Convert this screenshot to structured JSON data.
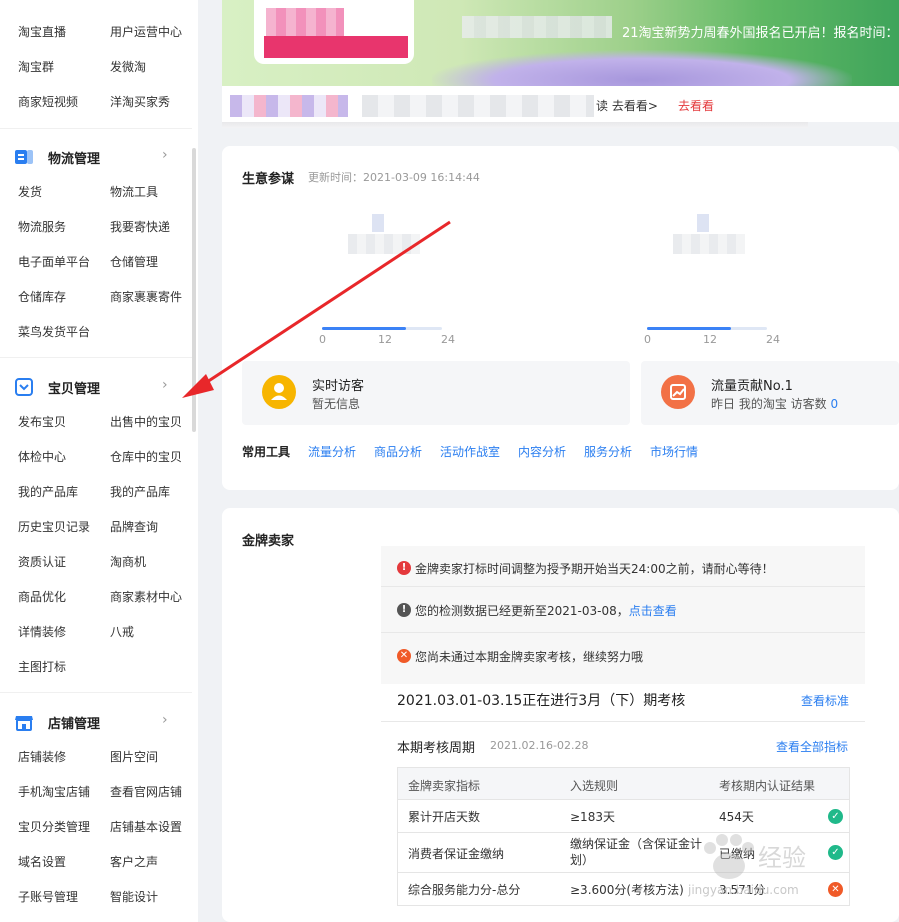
{
  "sidebar": {
    "top_links": [
      {
        "left": "淘宝直播",
        "right": "用户运营中心"
      },
      {
        "left": "淘宝群",
        "right": "发微淘"
      },
      {
        "left": "商家短视频",
        "right": "洋淘买家秀"
      }
    ],
    "sections": [
      {
        "title": "物流管理",
        "icon": "logistics-icon",
        "links": [
          {
            "left": "发货",
            "right": "物流工具"
          },
          {
            "left": "物流服务",
            "right": "我要寄快递"
          },
          {
            "left": "电子面单平台",
            "right": "仓储管理"
          },
          {
            "left": "仓储库存",
            "right": "商家裹裹寄件"
          },
          {
            "left": "菜鸟发货平台",
            "right": ""
          }
        ]
      },
      {
        "title": "宝贝管理",
        "icon": "product-icon",
        "links": [
          {
            "left": "发布宝贝",
            "right": "出售中的宝贝"
          },
          {
            "left": "体检中心",
            "right": "仓库中的宝贝"
          },
          {
            "left": "我的产品库",
            "right": "我的产品库"
          },
          {
            "left": "历史宝贝记录",
            "right": "品牌查询"
          },
          {
            "left": "资质认证",
            "right": "淘商机"
          },
          {
            "left": "商品优化",
            "right": "商家素材中心"
          },
          {
            "left": "详情装修",
            "right": "八戒"
          },
          {
            "left": "主图打标",
            "right": ""
          }
        ]
      },
      {
        "title": "店铺管理",
        "icon": "shop-icon",
        "links": [
          {
            "left": "店铺装修",
            "right": "图片空间"
          },
          {
            "left": "手机淘宝店铺",
            "right": "查看官网店铺"
          },
          {
            "left": "宝贝分类管理",
            "right": "店铺基本设置"
          },
          {
            "left": "域名设置",
            "right": "客户之声"
          },
          {
            "left": "子账号管理",
            "right": "智能设计"
          }
        ]
      }
    ]
  },
  "banner": {
    "text": "21淘宝新势力周春外国报名已开启！报名时间：",
    "sub_text": "读 去看看>",
    "sub_link": "去看看"
  },
  "business": {
    "title": "生意参谋",
    "update_time": "更新时间：2021-03-09 16:14:44",
    "gauges": [
      {
        "ticks": [
          "0",
          "12",
          "24"
        ],
        "fill_fraction": 0.7
      },
      {
        "ticks": [
          "0",
          "12",
          "24"
        ],
        "fill_fraction": 0.7
      }
    ],
    "stats": [
      {
        "title": "实时访客",
        "sub": "暂无信息",
        "value": ""
      },
      {
        "title": "流量贡献No.1",
        "sub": "昨日 我的淘宝 访客数",
        "value": "0"
      }
    ],
    "tools_label": "常用工具",
    "tools": [
      "流量分析",
      "商品分析",
      "活动作战室",
      "内容分析",
      "服务分析",
      "市场行情"
    ]
  },
  "gold": {
    "title": "金牌卖家",
    "notices": [
      {
        "icon": "!",
        "color": "#e4393c",
        "text": "金牌卖家打标时间调整为授予期开始当天24:00之前，请耐心等待！",
        "link": ""
      },
      {
        "icon": "!",
        "color": "#555555",
        "text": "您的检测数据已经更新至2021-03-08，",
        "link": "点击查看"
      },
      {
        "icon": "✕",
        "color": "#f05a28",
        "text": "您尚未通过本期金牌卖家考核，继续努力哦",
        "link": ""
      }
    ],
    "period_text": "2021.03.01-03.15正在进行3月（下）期考核",
    "period_link": "查看标准",
    "cycle_title": "本期考核周期",
    "cycle_date": "2021.02.16-02.28",
    "cycle_link": "查看全部指标",
    "table": {
      "headers": [
        "金牌卖家指标",
        "入选规则",
        "考核期内认证结果"
      ],
      "rows": [
        {
          "metric": "累计开店天数",
          "rule": "≥183天",
          "result": "454天",
          "status": "pass"
        },
        {
          "metric": "消费者保证金缴纳",
          "rule": "缴纳保证金（含保证金计划）",
          "result": "已缴纳",
          "status": "pass"
        },
        {
          "metric": "综合服务能力分-总分",
          "rule": "≥3.600分(考核方法)",
          "result": "3.571分",
          "status": "fail"
        }
      ]
    }
  },
  "watermark": "jingyan.baidu.com",
  "colors": {
    "accent": "#2a7ef0",
    "red": "#e4393c",
    "orange": "#f05a28",
    "green": "#20b98a"
  }
}
